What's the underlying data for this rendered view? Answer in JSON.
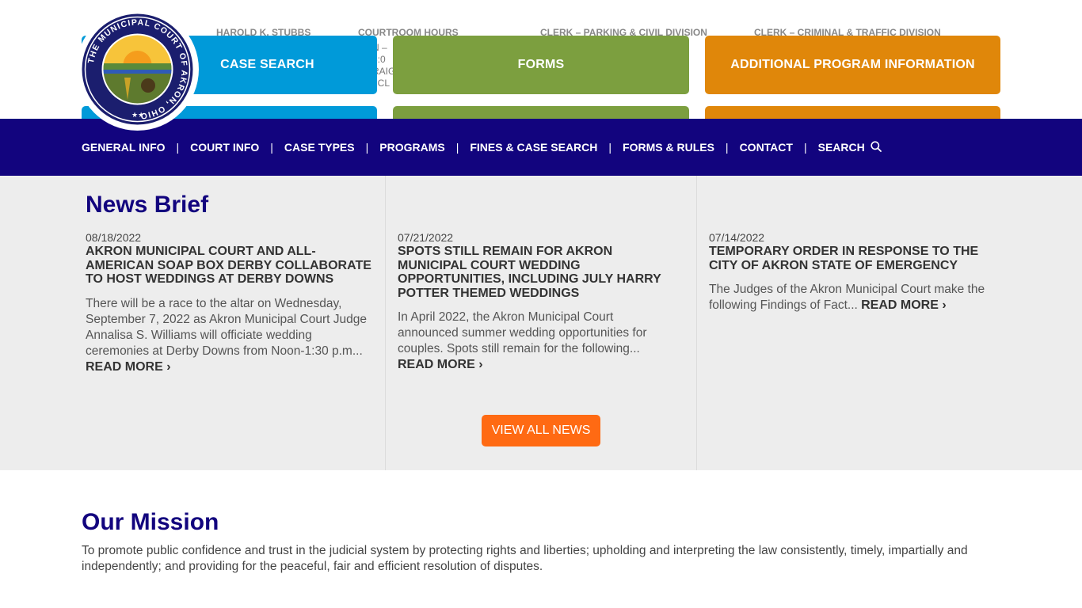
{
  "info_strip": [
    {
      "label": "HAROLD K. STUBBS",
      "sub": ""
    },
    {
      "label": "COURTROOM HOURS",
      "sub": "N –  8:0  RAIG  : CL"
    },
    {
      "label": "CLERK – PARKING & CIVIL DIVISION",
      "sub": ""
    },
    {
      "label": "CLERK – CRIMINAL & TRAFFIC DIVISION",
      "sub": ""
    }
  ],
  "tiles": {
    "case_search": "CASE SEARCH",
    "forms": "FORMS",
    "additional": "ADDITIONAL PROGRAM INFORMATION"
  },
  "seal": {
    "text": "THE MUNICIPAL COURT OF AKRON, OHIO"
  },
  "nav": {
    "items": [
      "GENERAL INFO",
      "COURT INFO",
      "CASE TYPES",
      "PROGRAMS",
      "FINES & CASE SEARCH",
      "FORMS & RULES",
      "CONTACT",
      "SEARCH"
    ],
    "separator": "|"
  },
  "news": {
    "title": "News Brief",
    "view_all": "VIEW ALL NEWS",
    "articles": [
      {
        "date": "08/18/2022",
        "headline": "AKRON MUNICIPAL COURT AND ALL-AMERICAN SOAP BOX DERBY COLLABORATE TO HOST WEDDINGS AT DERBY DOWNS",
        "excerpt": "There will be a race to the altar on Wednesday, September 7, 2022 as Akron Municipal Court Judge Annalisa S. Williams will officiate wedding ceremonies at Derby Downs from Noon-1:30 p.m...",
        "readmore": "READ MORE ›"
      },
      {
        "date": "07/21/2022",
        "headline": "SPOTS STILL REMAIN FOR AKRON MUNICIPAL COURT WEDDING OPPORTUNITIES, INCLUDING JULY HARRY POTTER THEMED WEDDINGS",
        "excerpt": "In April 2022, the Akron Municipal Court announced summer wedding opportunities for couples. Spots still remain for the following...",
        "readmore": "READ MORE ›"
      },
      {
        "date": "07/14/2022",
        "headline": "TEMPORARY ORDER IN RESPONSE TO THE CITY OF AKRON STATE OF EMERGENCY",
        "excerpt": "The Judges of the Akron Municipal Court make the following Findings of Fact...",
        "readmore": "READ MORE ›"
      }
    ]
  },
  "mission": {
    "title": "Our Mission",
    "text": "To promote public confidence and trust in the judicial system by protecting rights and liberties; upholding and interpreting the law consistently, timely, impartially and independently; and providing for the peaceful, fair and efficient resolution of disputes."
  },
  "colors": {
    "nav_bg": "#12047e",
    "tile_blue": "#009ad9",
    "tile_green": "#7c9f3f",
    "tile_orange": "#e0870a",
    "view_all": "#ff6a13",
    "heading": "#12047e"
  }
}
